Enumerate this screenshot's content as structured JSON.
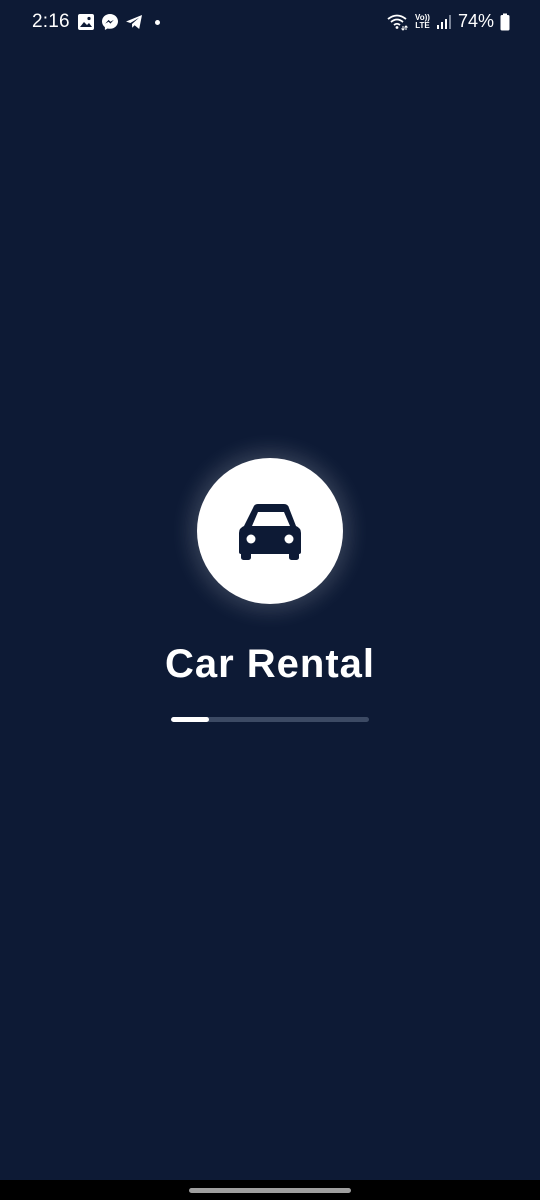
{
  "status_bar": {
    "time": "2:16",
    "left_icons": [
      "gallery-icon",
      "messenger-icon",
      "telegram-icon"
    ],
    "volte_top": "Vo))",
    "volte_bottom": "LTE",
    "battery_percent": "74%"
  },
  "splash": {
    "icon": "car-icon",
    "title": "Car Rental",
    "loading_progress": 0.19
  },
  "colors": {
    "background": "#0d1a35",
    "logo_circle": "#ffffff",
    "car_icon": "#0d1a35",
    "progress_track": "#3c4a64",
    "progress_fill": "#ffffff"
  }
}
